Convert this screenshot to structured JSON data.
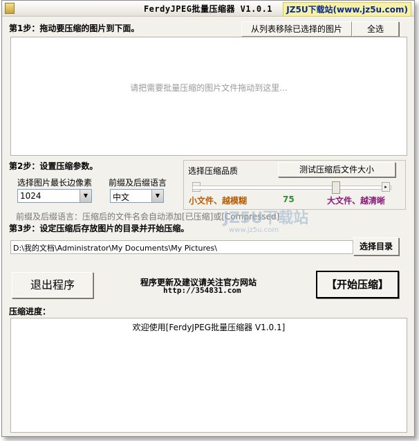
{
  "window": {
    "title": "FerdyJPEG批量压缩器 V1.0.1",
    "watermark_badge": "JZ5U下载站(www.jz5u.com)"
  },
  "step1": {
    "label": "第1步：拖动要压缩的图片到下面。",
    "remove_button": "从列表移除已选择的图片",
    "select_all_button": "全选",
    "drop_hint": "请把需要批量压缩的图片文件拖动到这里..."
  },
  "step2": {
    "label": "第2步：设置压缩参数。",
    "max_edge_label": "选择图片最长边像素",
    "max_edge_value": "1024",
    "prefix_lang_label": "前缀及后缀语言",
    "prefix_lang_value": "中文",
    "quality_label": "选择压缩品质",
    "test_size_button": "测试压缩后文件大小",
    "small_label": "小文件、越模糊",
    "quality_value": "75",
    "large_label": "大文件、越清晰",
    "note": "前缀及后缀语言：压缩后的文件名会自动添加[已压缩]或[Compressed]",
    "quality_fraction": 0.75,
    "small_color": "#b85a00",
    "quality_color": "#2f8f2f",
    "large_color": "#8a1a7a"
  },
  "step3": {
    "label": "第3步：设定压缩后存放图片的目录并开始压缩。",
    "path_value": "D:\\我的文档\\Administrator\\My Documents\\My Pictures\\",
    "choose_dir_button": "选择目录"
  },
  "actions": {
    "exit_button": "退出程序",
    "update_line1": "程序更新及建议请关注官方网站",
    "update_line2": "http://354831.com",
    "start_button": "【开始压缩】"
  },
  "progress": {
    "label": "压缩进度：",
    "log_line": "欢迎使用[FerdyJPEG批量压缩器 V1.0.1]"
  },
  "watermark": {
    "text": "JZ5U下载站",
    "url": "www.jz5u.com"
  }
}
